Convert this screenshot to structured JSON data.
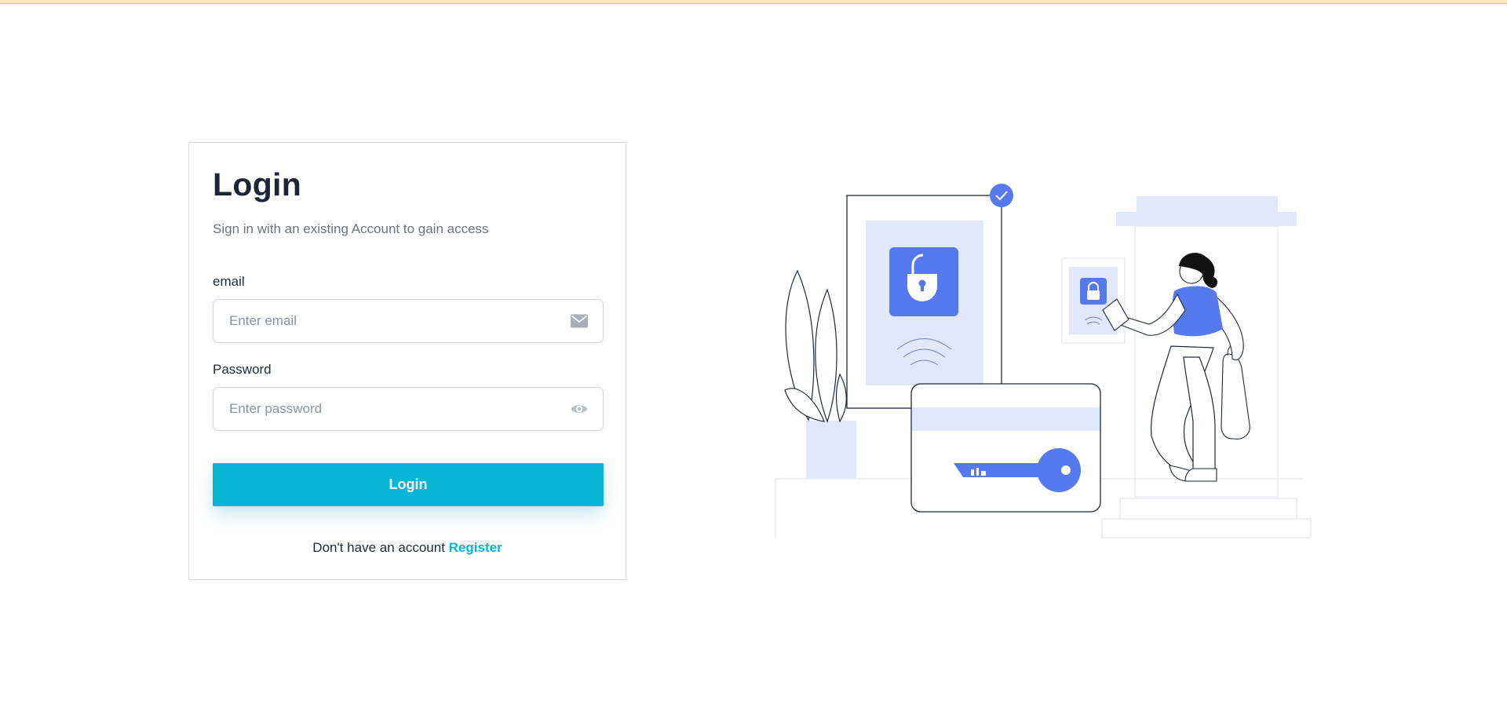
{
  "colors": {
    "accent": "#08b5d6",
    "illustration_blue": "#5679ee",
    "illustration_light": "#e1e8fb",
    "title": "#1d2536"
  },
  "login": {
    "title": "Login",
    "subtitle": "Sign in with an existing Account to gain access",
    "email": {
      "label": "email",
      "placeholder": "Enter email",
      "value": "",
      "icon": "envelope-icon"
    },
    "password": {
      "label": "Password",
      "placeholder": "Enter password",
      "value": "",
      "icon": "eye-icon"
    },
    "submit_label": "Login",
    "register_prompt": "Don't have an account",
    "register_link": "Register"
  },
  "illustration": {
    "name": "security-unlock-illustration"
  }
}
